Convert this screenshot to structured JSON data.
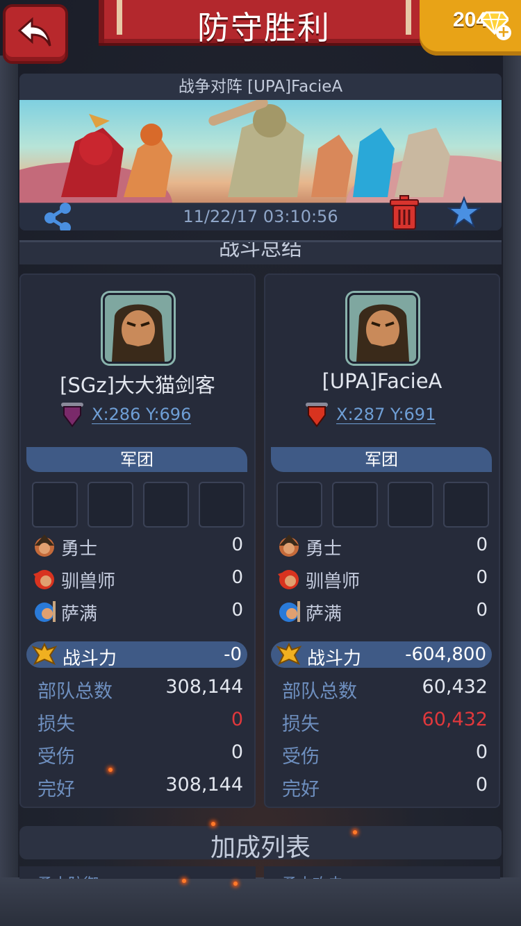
{
  "header": {
    "title": "防守胜利",
    "gems": "204",
    "plus": "+"
  },
  "battle": {
    "title": "战争对阵 [UPA]FacieA",
    "datetime": "11/22/17 03:10:56"
  },
  "summary_title": "战斗总结",
  "left": {
    "name": "[SGz]大大猫剑客",
    "coords": "X:286 Y:696",
    "flag_color": "#7a2a6a",
    "legion_label": "军团",
    "troops": [
      {
        "label": "勇士",
        "value": "0",
        "icon": "warrior-icon"
      },
      {
        "label": "驯兽师",
        "value": "0",
        "icon": "beast-tamer-icon"
      },
      {
        "label": "萨满",
        "value": "0",
        "icon": "shaman-icon"
      }
    ],
    "power_label": "战斗力",
    "power_value": "-0",
    "stats": [
      {
        "label": "部队总数",
        "value": "308,144"
      },
      {
        "label": "损失",
        "value": "0",
        "red": true
      },
      {
        "label": "受伤",
        "value": "0"
      },
      {
        "label": "完好",
        "value": "308,144"
      }
    ]
  },
  "right": {
    "name": "[UPA]FacieA",
    "coords": "X:287 Y:691",
    "flag_color": "#d8331f",
    "legion_label": "军团",
    "troops": [
      {
        "label": "勇士",
        "value": "0",
        "icon": "warrior-icon"
      },
      {
        "label": "驯兽师",
        "value": "0",
        "icon": "beast-tamer-icon"
      },
      {
        "label": "萨满",
        "value": "0",
        "icon": "shaman-icon"
      }
    ],
    "power_label": "战斗力",
    "power_value": "-604,800",
    "stats": [
      {
        "label": "部队总数",
        "value": "60,432"
      },
      {
        "label": "损失",
        "value": "60,432",
        "red": true
      },
      {
        "label": "受伤",
        "value": "0"
      },
      {
        "label": "完好",
        "value": "0"
      }
    ]
  },
  "bonus": {
    "title": "加成列表",
    "left_peek": "勇士防御",
    "right_peek": "勇士攻击"
  },
  "colors": {
    "accent_blue": "#3f5a86",
    "loss_red": "#e0383c",
    "banner_red": "#b3282d",
    "gem_gold": "#e8a317"
  }
}
